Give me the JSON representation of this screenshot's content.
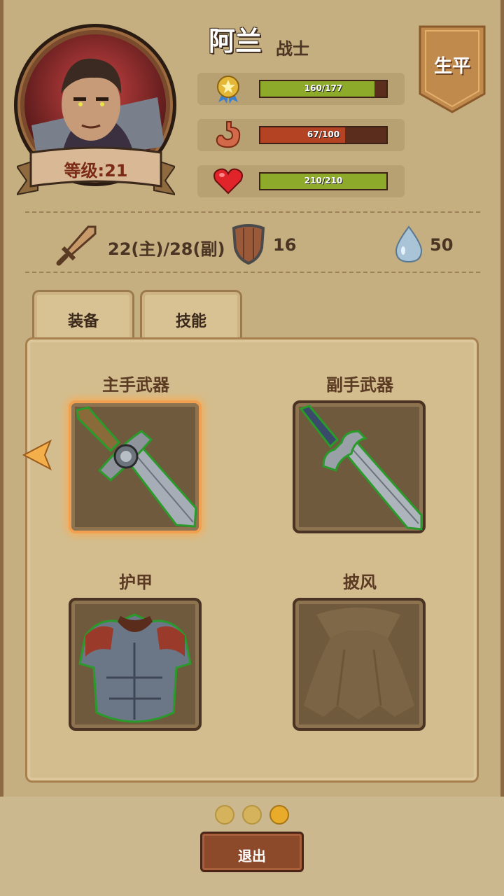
{
  "character": {
    "name": "阿兰",
    "class": "战士",
    "level_label": "等级:21"
  },
  "bio_button": "生平",
  "stats": {
    "exp": {
      "label": "160/177",
      "fraction": 0.904,
      "icon": "medal-icon",
      "color": "#8eaa2b"
    },
    "hunger": {
      "label": "67/100",
      "fraction": 0.67,
      "icon": "stomach-icon",
      "color": "#b34323"
    },
    "health": {
      "label": "210/210",
      "fraction": 1.0,
      "icon": "heart-icon",
      "color": "#8eaa2b"
    }
  },
  "attributes": {
    "attack": "22(主)/28(副)",
    "defense": "16",
    "water": "50"
  },
  "tabs": [
    {
      "label": "装备"
    },
    {
      "label": "技能"
    }
  ],
  "equipment": {
    "main_weapon": {
      "title": "主手武器",
      "icon": "sword-icon"
    },
    "off_weapon": {
      "title": "副手武器",
      "icon": "dagger-icon"
    },
    "armor": {
      "title": "护甲",
      "icon": "armor-icon"
    },
    "cloak": {
      "title": "披风",
      "icon": "cloak-icon"
    }
  },
  "pagination": {
    "pages": 3,
    "current": 3
  },
  "exit_button": "退出"
}
